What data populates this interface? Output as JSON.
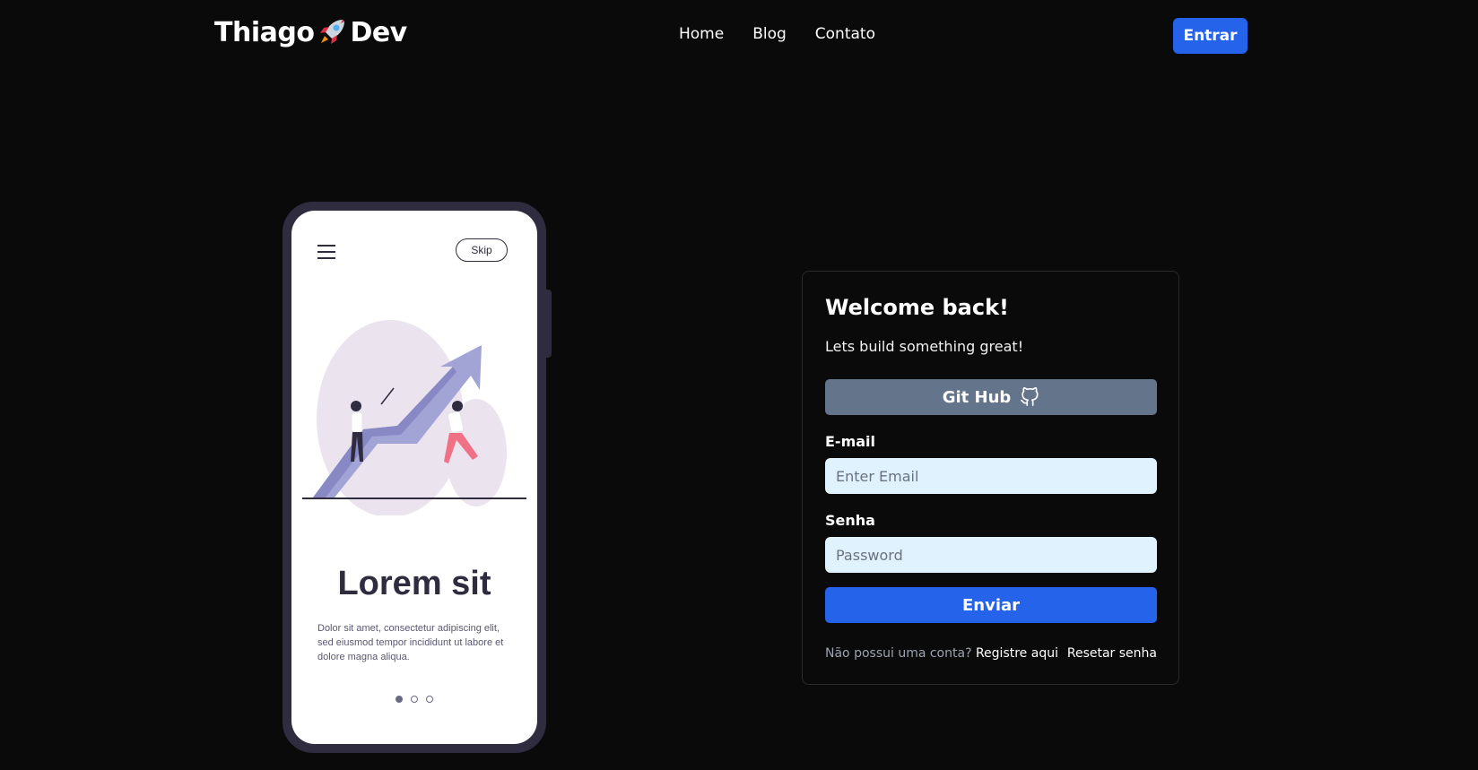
{
  "header": {
    "logo_left": "Thiago",
    "logo_icon": "rocket-icon",
    "logo_right": "Dev",
    "nav": [
      "Home",
      "Blog",
      "Contato"
    ],
    "login_button": "Entrar"
  },
  "phone": {
    "skip_label": "Skip",
    "title": "Lorem sit",
    "body": "Dolor sit amet, consectetur adipiscing elit, sed eiusmod tempor incididunt ut labore et dolore magna aliqua.",
    "dots_total": 3,
    "dots_active": 1
  },
  "login": {
    "title": "Welcome back!",
    "subtitle": "Lets build something great!",
    "github_button": "Git Hub",
    "email_label": "E-mail",
    "email_placeholder": "Enter Email",
    "password_label": "Senha",
    "password_placeholder": "Password",
    "submit_button": "Enviar",
    "no_account_text": "Não possui uma conta?",
    "register_link": "Registre aqui",
    "reset_link": "Resetar senha"
  },
  "colors": {
    "background": "#0a0a0a",
    "accent": "#2563eb",
    "github_button": "#64748b",
    "input_bg": "#e0f2fe",
    "phone_frame": "#2e2c3e"
  }
}
